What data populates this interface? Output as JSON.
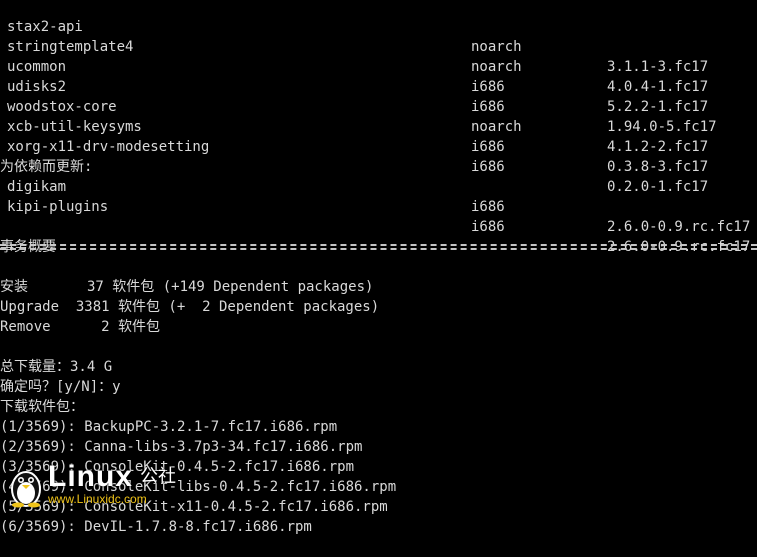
{
  "terminal": {
    "packages_upper": [
      {
        "name": "stax2-api",
        "arch": "noarch",
        "version": "3.1.1-3.fc17"
      },
      {
        "name": "stringtemplate4",
        "arch": "noarch",
        "version": "4.0.4-1.fc17"
      },
      {
        "name": "ucommon",
        "arch": "i686",
        "version": "5.2.2-1.fc17"
      },
      {
        "name": "udisks2",
        "arch": "i686",
        "version": "1.94.0-5.fc17"
      },
      {
        "name": "woodstox-core",
        "arch": "noarch",
        "version": "4.1.2-2.fc17"
      },
      {
        "name": "xcb-util-keysyms",
        "arch": "i686",
        "version": "0.3.8-3.fc17"
      },
      {
        "name": "xorg-x11-drv-modesetting",
        "arch": "i686",
        "version": "0.2.0-1.fc17"
      }
    ],
    "dependency_updates_heading": "为依赖而更新:",
    "packages_dep": [
      {
        "name": "digikam",
        "arch": "i686",
        "version": "2.6.0-0.9.rc.fc17"
      },
      {
        "name": "kipi-plugins",
        "arch": "i686",
        "version": "2.6.0-0.9.rc.fc17"
      }
    ],
    "summary_heading": "事务概要",
    "summary_lines": [
      "安装       37 软件包 (+149 Dependent packages)",
      "Upgrade  3381 软件包 (+  2 Dependent packages)",
      "Remove      2 软件包"
    ],
    "total_download": "总下载量：3.4 G",
    "confirm_prompt": "确定吗？[y/N]：y",
    "downloading_heading": "下载软件包：",
    "downloads": [
      "(1/3569): BackupPC-3.2.1-7.fc17.i686.rpm",
      "(2/3569): Canna-libs-3.7p3-34.fc17.i686.rpm",
      "(3/3569): ConsoleKit-0.4.5-2.fc17.i686.rpm",
      "(4/3569): ConsoleKit-libs-0.4.5-2.fc17.i686.rpm",
      "(5/3569): ConsoleKit-x11-0.4.5-2.fc17.i686.rpm",
      "(6/3569): DevIL-1.7.8-8.fc17.i686.rpm"
    ]
  },
  "watermark": {
    "brand": "Linux",
    "brand_cn": "公社",
    "url": "www.Linuxidc.com"
  },
  "colors": {
    "background": "#000000",
    "text": "#d9d9d9",
    "url": "#f0c419"
  }
}
